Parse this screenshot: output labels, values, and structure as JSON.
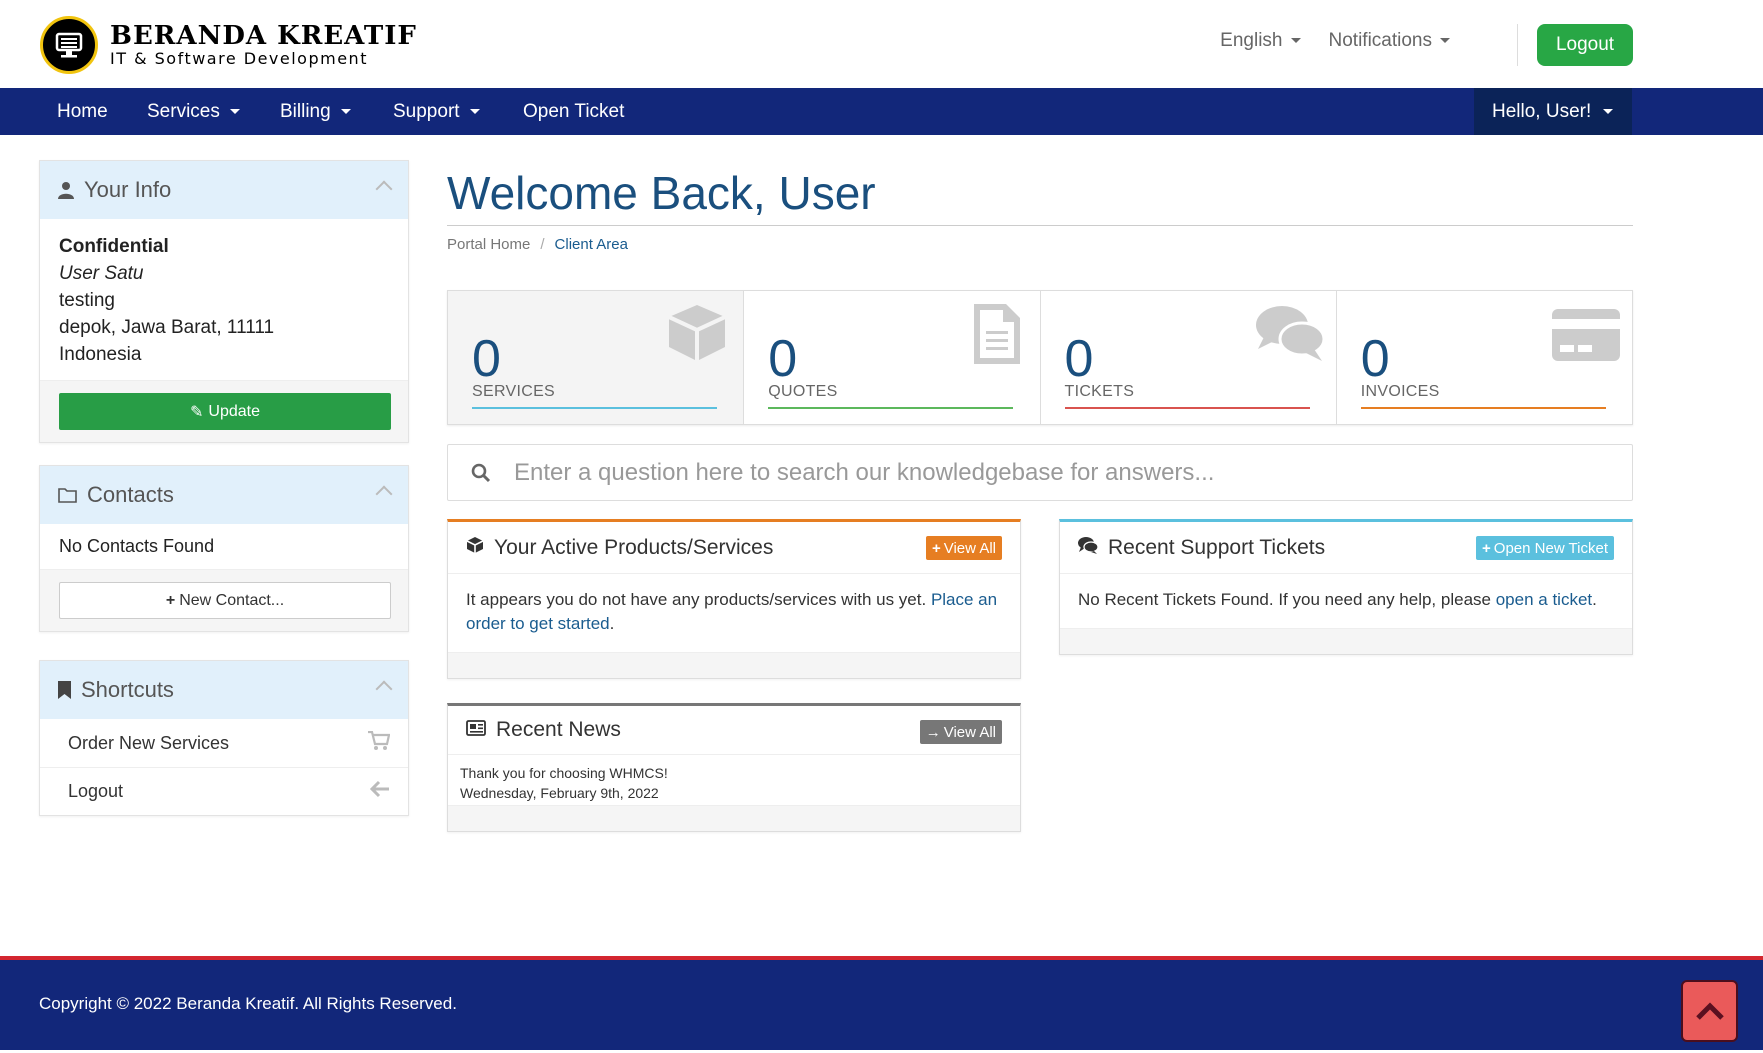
{
  "header": {
    "brand_title": "BERANDA KREATIF",
    "brand_subtitle": "IT & Software Development",
    "language": "English",
    "notifications": "Notifications",
    "logout": "Logout"
  },
  "nav": {
    "items": [
      {
        "label": "Home",
        "has_caret": false
      },
      {
        "label": "Services",
        "has_caret": true
      },
      {
        "label": "Billing",
        "has_caret": true
      },
      {
        "label": "Support",
        "has_caret": true
      },
      {
        "label": "Open Ticket",
        "has_caret": false
      }
    ],
    "user_menu": "Hello, User!"
  },
  "sidebar": {
    "your_info": {
      "title": "Your Info",
      "company": "Confidential",
      "name": "User Satu",
      "address1": "testing",
      "address2": "depok, Jawa Barat, 11111",
      "country": "Indonesia",
      "update_button": "Update"
    },
    "contacts": {
      "title": "Contacts",
      "empty_text": "No Contacts Found",
      "new_button": "New Contact..."
    },
    "shortcuts": {
      "title": "Shortcuts",
      "items": [
        {
          "label": "Order New Services",
          "icon": "cart-icon"
        },
        {
          "label": "Logout",
          "icon": "arrow-left-icon"
        }
      ]
    }
  },
  "main": {
    "title": "Welcome Back, User",
    "breadcrumb": {
      "home": "Portal Home",
      "current": "Client Area"
    },
    "tiles": [
      {
        "count": "0",
        "label": "SERVICES",
        "color": "#5bc0de",
        "icon": "cube-icon"
      },
      {
        "count": "0",
        "label": "QUOTES",
        "color": "#5cb85c",
        "icon": "document-icon"
      },
      {
        "count": "0",
        "label": "TICKETS",
        "color": "#d9534f",
        "icon": "comments-icon"
      },
      {
        "count": "0",
        "label": "INVOICES",
        "color": "#e67e22",
        "icon": "credit-card-icon"
      }
    ],
    "search_placeholder": "Enter a question here to search our knowledgebase for answers...",
    "products_card": {
      "title": "Your Active Products/Services",
      "button": "View All",
      "text": "It appears you do not have any products/services with us yet.",
      "link": "Place an order to get started",
      "after": "."
    },
    "tickets_card": {
      "title": "Recent Support Tickets",
      "button": "Open New Ticket",
      "text": "No Recent Tickets Found. If you need any help, please",
      "link": "open a ticket",
      "after": "."
    },
    "news_card": {
      "title": "Recent News",
      "button": "View All",
      "headline": "Thank you for choosing WHMCS!",
      "date": "Wednesday, February 9th, 2022"
    }
  },
  "footer": {
    "copyright": "Copyright © 2022 Beranda Kreatif. All Rights Reserved."
  },
  "colors": {
    "nav_bg": "#12277a",
    "accent_green": "#28a745",
    "products_border": "#e67e22",
    "tickets_border": "#5bc0de",
    "news_border": "#777777",
    "footer_line": "#d32630"
  }
}
